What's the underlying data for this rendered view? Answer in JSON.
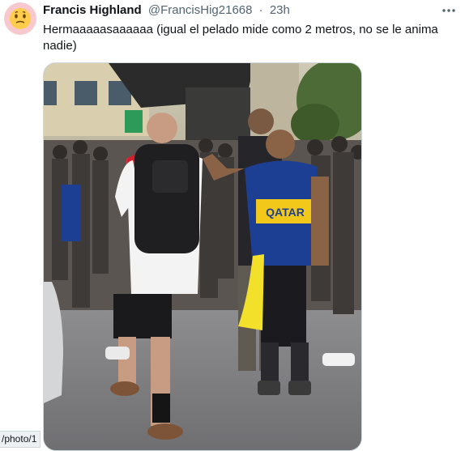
{
  "tweet": {
    "author_name": "Francis Highland",
    "author_handle": "@FrancisHig21668",
    "separator": "·",
    "time": "23h",
    "text": "Hermaaaaasaaaaaa (igual el pelado mide como 2 metros, no se le anima nadie)",
    "avatar_icon": "grimacing-face-emoji-icon",
    "more_icon": "more-horizontal-icon"
  },
  "media": {
    "jersey_text": "QATAR"
  },
  "status_bar": {
    "url_fragment": "/photo/1"
  },
  "colors": {
    "avatar_bg": "#f7c9cf",
    "secondary_text": "#536471",
    "boca_blue": "#1d3f93",
    "boca_yellow": "#f2c81b",
    "river_red": "#d21f2b"
  }
}
